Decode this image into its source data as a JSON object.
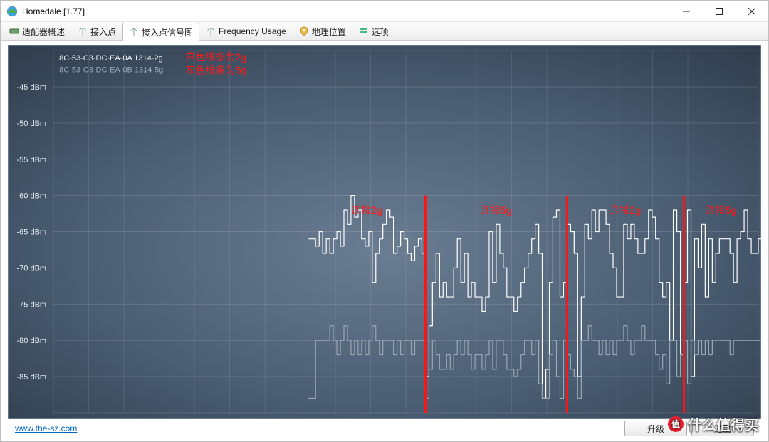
{
  "window": {
    "title": "Homedale [1.77]"
  },
  "toolbar": {
    "tabs": [
      {
        "label": "适配器概述"
      },
      {
        "label": "接入点"
      },
      {
        "label": "接入点信号图"
      },
      {
        "label": "Frequency Usage"
      },
      {
        "label": "地理位置"
      },
      {
        "label": "选项"
      }
    ]
  },
  "legend": {
    "line1": "8C-53-C3-DC-EA-0A 1314-2g",
    "line2": "8C-53-C3-DC-EA-0B 1314-5g",
    "ann1": "白色线条为2g",
    "ann2": "灰色线条为5g"
  },
  "annotations": {
    "seg1": "连接2g",
    "seg2": "连接5g",
    "seg3": "连接2g",
    "seg4": "连接5g"
  },
  "footer": {
    "url": "www.the-sz.com",
    "btn1": "升级",
    "btn2": "退出"
  },
  "watermark": {
    "badge": "值",
    "text": "什么值得买"
  },
  "chart_data": {
    "type": "line",
    "ylabel": "dBm",
    "ylim": [
      -90,
      -40
    ],
    "yticks": [
      -45,
      -50,
      -55,
      -60,
      -65,
      -70,
      -75,
      -80,
      -85
    ],
    "ytick_labels": [
      "-45 dBm",
      "-50 dBm",
      "-55 dBm",
      "-60 dBm",
      "-65 dBm",
      "-70 dBm",
      "-75 dBm",
      "-80 dBm",
      "-85 dBm"
    ],
    "x_count": 200,
    "markers_x": [
      105,
      145,
      178
    ],
    "series": [
      {
        "name": "8C-53-C3-DC-EA-0A 1314-2g",
        "color": "#ffffff",
        "values": [
          null,
          null,
          null,
          null,
          null,
          null,
          null,
          null,
          null,
          null,
          null,
          null,
          null,
          null,
          null,
          null,
          null,
          null,
          null,
          null,
          null,
          null,
          null,
          null,
          null,
          null,
          null,
          null,
          null,
          null,
          null,
          null,
          null,
          null,
          null,
          null,
          null,
          null,
          null,
          null,
          null,
          null,
          null,
          null,
          null,
          null,
          null,
          null,
          null,
          null,
          null,
          null,
          null,
          null,
          null,
          null,
          null,
          null,
          null,
          null,
          null,
          null,
          null,
          null,
          null,
          null,
          null,
          null,
          null,
          null,
          null,
          null,
          -66,
          -66,
          -67,
          -65,
          -68,
          -66,
          -68,
          -66,
          -65,
          -67,
          -62,
          -64,
          -60,
          -63,
          -62,
          -66,
          -67,
          -65,
          -72,
          -68,
          -66,
          -64,
          -62,
          -63,
          -68,
          -67,
          -65,
          -66,
          -68,
          -69,
          -67,
          -66,
          -68,
          -85,
          -78,
          -72,
          -68,
          -74,
          -72,
          -74,
          -74,
          -70,
          -66,
          -72,
          -68,
          -74,
          -72,
          -74,
          -74,
          -76,
          -74,
          -65,
          -72,
          -64,
          -68,
          -70,
          -74,
          -74,
          -76,
          -74,
          -72,
          -70,
          -68,
          -66,
          -64,
          -68,
          -88,
          -84,
          -72,
          -63,
          -62,
          -74,
          -72,
          -64,
          -65,
          -68,
          -85,
          -74,
          -64,
          -66,
          -62,
          -65,
          -62,
          -62,
          -64,
          -68,
          -70,
          -74,
          -74,
          -64,
          -66,
          -64,
          -66,
          -68,
          -68,
          -66,
          -62,
          -63,
          -66,
          -72,
          -74,
          -72,
          -80,
          -62,
          -65,
          -82,
          -72,
          -62,
          -85,
          -66,
          -70,
          -64,
          -74,
          -66,
          -72,
          -68,
          -66,
          -66,
          -66,
          -68,
          -72,
          -66,
          -65,
          -62,
          -66,
          -68,
          -68,
          -66,
          -64,
          -68
        ]
      },
      {
        "name": "8C-53-C3-DC-EA-0B 1314-5g",
        "color": "#9aa8b6",
        "values": [
          null,
          null,
          null,
          null,
          null,
          null,
          null,
          null,
          null,
          null,
          null,
          null,
          null,
          null,
          null,
          null,
          null,
          null,
          null,
          null,
          null,
          null,
          null,
          null,
          null,
          null,
          null,
          null,
          null,
          null,
          null,
          null,
          null,
          null,
          null,
          null,
          null,
          null,
          null,
          null,
          null,
          null,
          null,
          null,
          null,
          null,
          null,
          null,
          null,
          null,
          null,
          null,
          null,
          null,
          null,
          null,
          null,
          null,
          null,
          null,
          null,
          null,
          null,
          null,
          null,
          null,
          null,
          null,
          null,
          null,
          null,
          null,
          -88,
          -88,
          -80,
          -80,
          -80,
          -80,
          -78,
          -80,
          -82,
          -80,
          -78,
          -80,
          -82,
          -80,
          -82,
          -80,
          -82,
          -80,
          -78,
          -80,
          -82,
          -80,
          -80,
          -80,
          -82,
          -80,
          -82,
          -80,
          -80,
          -82,
          -80,
          -80,
          -80,
          -88,
          -84,
          -80,
          -82,
          -84,
          -84,
          -82,
          -84,
          -82,
          -80,
          -82,
          -80,
          -82,
          -84,
          -82,
          -82,
          -84,
          -82,
          -80,
          -84,
          -80,
          -80,
          -82,
          -84,
          -84,
          -85,
          -84,
          -82,
          -80,
          -80,
          -82,
          -80,
          -86,
          -88,
          -88,
          -82,
          -80,
          -85,
          -88,
          -80,
          -82,
          -84,
          -85,
          -88,
          -80,
          -80,
          -78,
          -80,
          -80,
          -82,
          -80,
          -82,
          -80,
          -82,
          -80,
          -80,
          -78,
          -80,
          -82,
          -80,
          -80,
          -78,
          -80,
          -80,
          -80,
          -82,
          -84,
          -82,
          -86,
          -80,
          -80,
          -85,
          -82,
          -80,
          -86,
          -80,
          -82,
          -80,
          -82,
          -80,
          -82,
          -80,
          -80,
          -80,
          -80,
          -80,
          -82,
          -80,
          -80,
          -80,
          -80,
          -80,
          -80,
          -80,
          -80,
          -80
        ]
      }
    ]
  }
}
